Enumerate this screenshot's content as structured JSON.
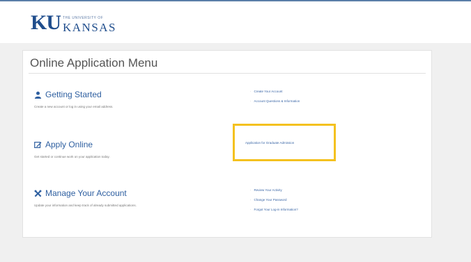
{
  "logo": {
    "ku": "KU",
    "small": "THE UNIVERSITY OF",
    "kansas": "KANSAS"
  },
  "menu": {
    "title": "Online Application Menu",
    "sections": [
      {
        "title": "Getting Started",
        "icon": "person-icon",
        "description": "Create a new account or log in using your email address.",
        "links": [
          "Create Your Account",
          "Account Questions & Information"
        ]
      },
      {
        "title": "Apply Online",
        "icon": "edit-icon",
        "description": "Get started or continue work on your application today.",
        "links": [
          "Application for Graduate Admission"
        ]
      },
      {
        "title": "Manage Your Account",
        "icon": "tools-icon",
        "description": "Update your information and keep track of already submitted applications.",
        "links": [
          "Review Your Activity",
          "Change Your Password",
          "Forgot Your Log-in Information?"
        ]
      }
    ]
  },
  "colors": {
    "brand": "#1f4d8c",
    "link": "#2e5fa0",
    "highlight": "#f4c11f"
  }
}
